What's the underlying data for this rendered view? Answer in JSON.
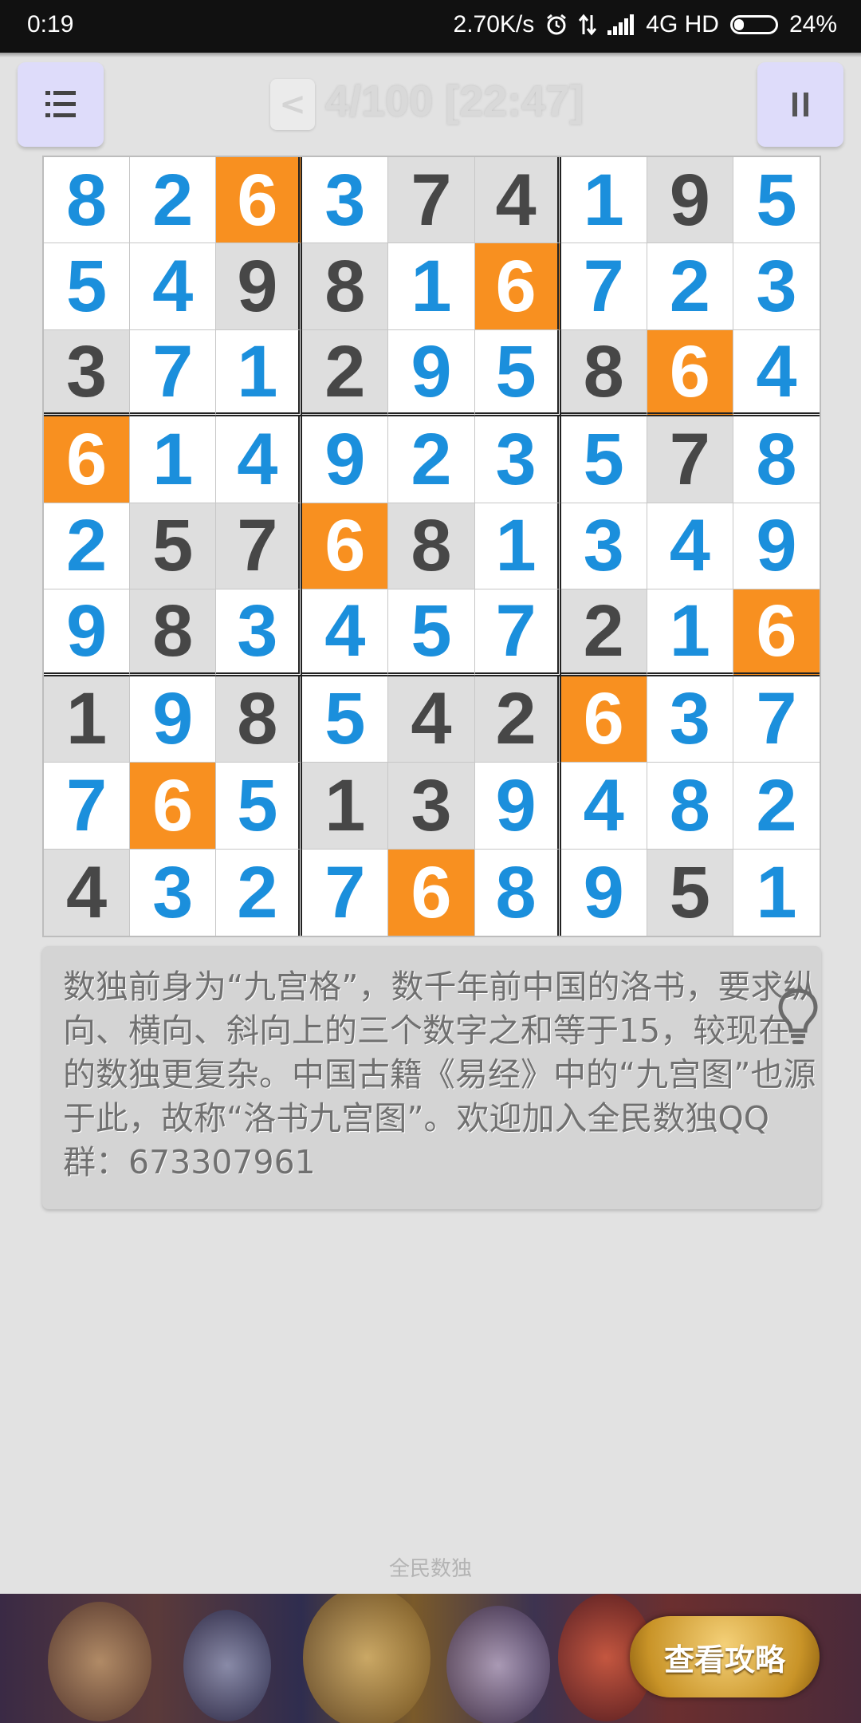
{
  "status_bar": {
    "time": "0:19",
    "net_speed": "2.70K/s",
    "network": "4G HD",
    "battery_text": "24%",
    "battery_level": 0.24,
    "icons": [
      "alarm-icon",
      "data-arrows-icon",
      "signal-icon",
      "battery-icon"
    ]
  },
  "header": {
    "menu_icon": "list-icon",
    "back_label": "<",
    "level_timer": "4/100 [22:47]",
    "pause_icon": "pause-icon"
  },
  "board": {
    "rows": [
      [
        8,
        2,
        6,
        3,
        7,
        4,
        1,
        9,
        5
      ],
      [
        5,
        4,
        9,
        8,
        1,
        6,
        7,
        2,
        3
      ],
      [
        3,
        7,
        1,
        2,
        9,
        5,
        8,
        6,
        4
      ],
      [
        6,
        1,
        4,
        9,
        2,
        3,
        5,
        7,
        8
      ],
      [
        2,
        5,
        7,
        6,
        8,
        1,
        3,
        4,
        9
      ],
      [
        9,
        8,
        3,
        4,
        5,
        7,
        2,
        1,
        6
      ],
      [
        1,
        9,
        8,
        5,
        4,
        2,
        6,
        3,
        7
      ],
      [
        7,
        6,
        5,
        1,
        3,
        9,
        4,
        8,
        2
      ],
      [
        4,
        3,
        2,
        7,
        6,
        8,
        9,
        5,
        1
      ]
    ],
    "given": [
      [
        0,
        0,
        0,
        0,
        1,
        1,
        0,
        1,
        0
      ],
      [
        0,
        0,
        1,
        1,
        0,
        0,
        0,
        0,
        0
      ],
      [
        1,
        0,
        0,
        1,
        0,
        0,
        1,
        0,
        0
      ],
      [
        0,
        0,
        0,
        0,
        0,
        0,
        0,
        1,
        0
      ],
      [
        0,
        1,
        1,
        0,
        1,
        0,
        0,
        0,
        0
      ],
      [
        0,
        1,
        0,
        0,
        0,
        0,
        1,
        0,
        0
      ],
      [
        1,
        0,
        1,
        0,
        1,
        1,
        0,
        0,
        0
      ],
      [
        0,
        0,
        0,
        1,
        1,
        0,
        0,
        0,
        0
      ],
      [
        1,
        0,
        0,
        0,
        0,
        0,
        0,
        1,
        0
      ]
    ],
    "highlight_digit": 6,
    "colors": {
      "user_digit": "#1b8fdc",
      "given_digit": "#474747",
      "given_bg": "#dedede",
      "highlight_bg": "#f89020"
    }
  },
  "info_card": {
    "text": "数独前身为“九宫格”，数千年前中国的洛书，要求纵向、横向、斜向上的三个数字之和等于15，较现在的数独更复杂。中国古籍《易经》中的“九宫图”也源于此，故称“洛书九宫图”。欢迎加入全民数独QQ群：673307961",
    "icon": "lightbulb-icon"
  },
  "footer": {
    "app_name": "全民数独"
  },
  "ad": {
    "cta_label": "查看攻略"
  }
}
